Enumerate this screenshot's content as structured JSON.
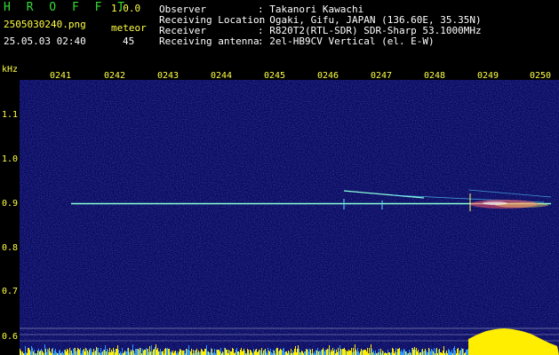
{
  "header": {
    "app_name": "H R O F F T",
    "version": "1.0.0",
    "filename": "2505030240.png",
    "timestamp": "25.05.03 02:40",
    "meteor_label": "meteor",
    "meteor_count": "45"
  },
  "info": [
    {
      "key": "Observer",
      "value": ": Takanori Kawachi"
    },
    {
      "key": "Receiving Location",
      "value": ": Ogaki, Gifu, JAPAN (136.60E, 35.35N)"
    },
    {
      "key": "Receiver",
      "value": ": R820T2(RTL-SDR) SDR-Sharp 53.1000MHz"
    },
    {
      "key": "Receiving antenna",
      "value": ": 2el-HB9CV Vertical (el. E-W)"
    }
  ],
  "axis": {
    "y_unit": "kHz",
    "time_labels": [
      "0241",
      "0242",
      "0243",
      "0244",
      "0245",
      "0246",
      "0247",
      "0248",
      "0249",
      "0250"
    ],
    "freq_labels": [
      "1.1",
      "1.0",
      "0.9",
      "0.8",
      "0.7",
      "0.6"
    ]
  },
  "colors": {
    "background": "#0a0a5a",
    "carrier": "#66ffcc",
    "label_yellow": "#ffff44",
    "header_green": "#33dd33",
    "bar_blue": "#3399ff",
    "bar_yellow": "#ffee00"
  }
}
